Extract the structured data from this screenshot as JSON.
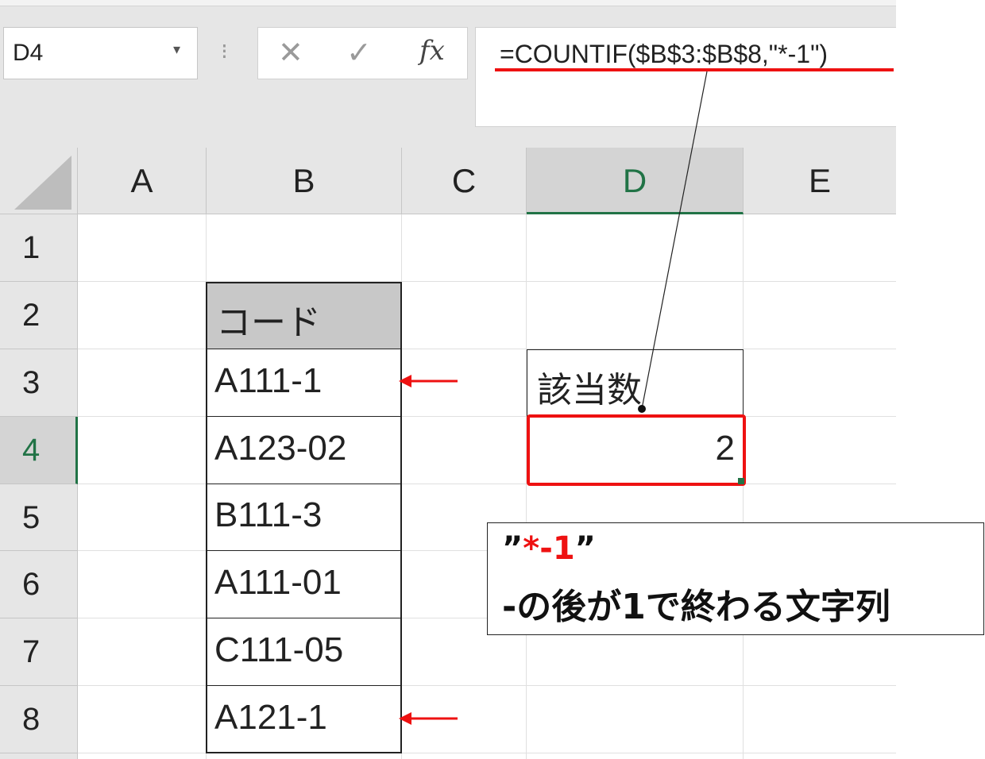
{
  "name_box": {
    "value": "D4"
  },
  "formula_bar": {
    "formula": "=COUNTIF($B$3:$B$8,\"*-1\")"
  },
  "icons": {
    "dropdown": "chevron-down-icon",
    "cancel": "close-icon",
    "enter": "check-icon",
    "fx": "function-icon",
    "arrow": "arrow-left-icon"
  },
  "columns": [
    "A",
    "B",
    "C",
    "D",
    "E"
  ],
  "rows": [
    "1",
    "2",
    "3",
    "4",
    "5",
    "6",
    "7",
    "8"
  ],
  "selected_cell": {
    "column": "D",
    "row": "4"
  },
  "cells": {
    "B2": "コード",
    "B3": "A111-1",
    "B4": "A123-02",
    "B5": "B111-3",
    "B6": "A111-01",
    "B7": "C111-05",
    "B8": "A121-1",
    "D3": "該当数",
    "D4": "2"
  },
  "callout": {
    "quote_open": "”",
    "pattern": "*-1",
    "quote_close": "”",
    "description": "-の後が1で終わる文字列"
  },
  "colors": {
    "highlight": "#ee1111",
    "selection": "#217346",
    "header_fill": "#c8c8c8"
  }
}
